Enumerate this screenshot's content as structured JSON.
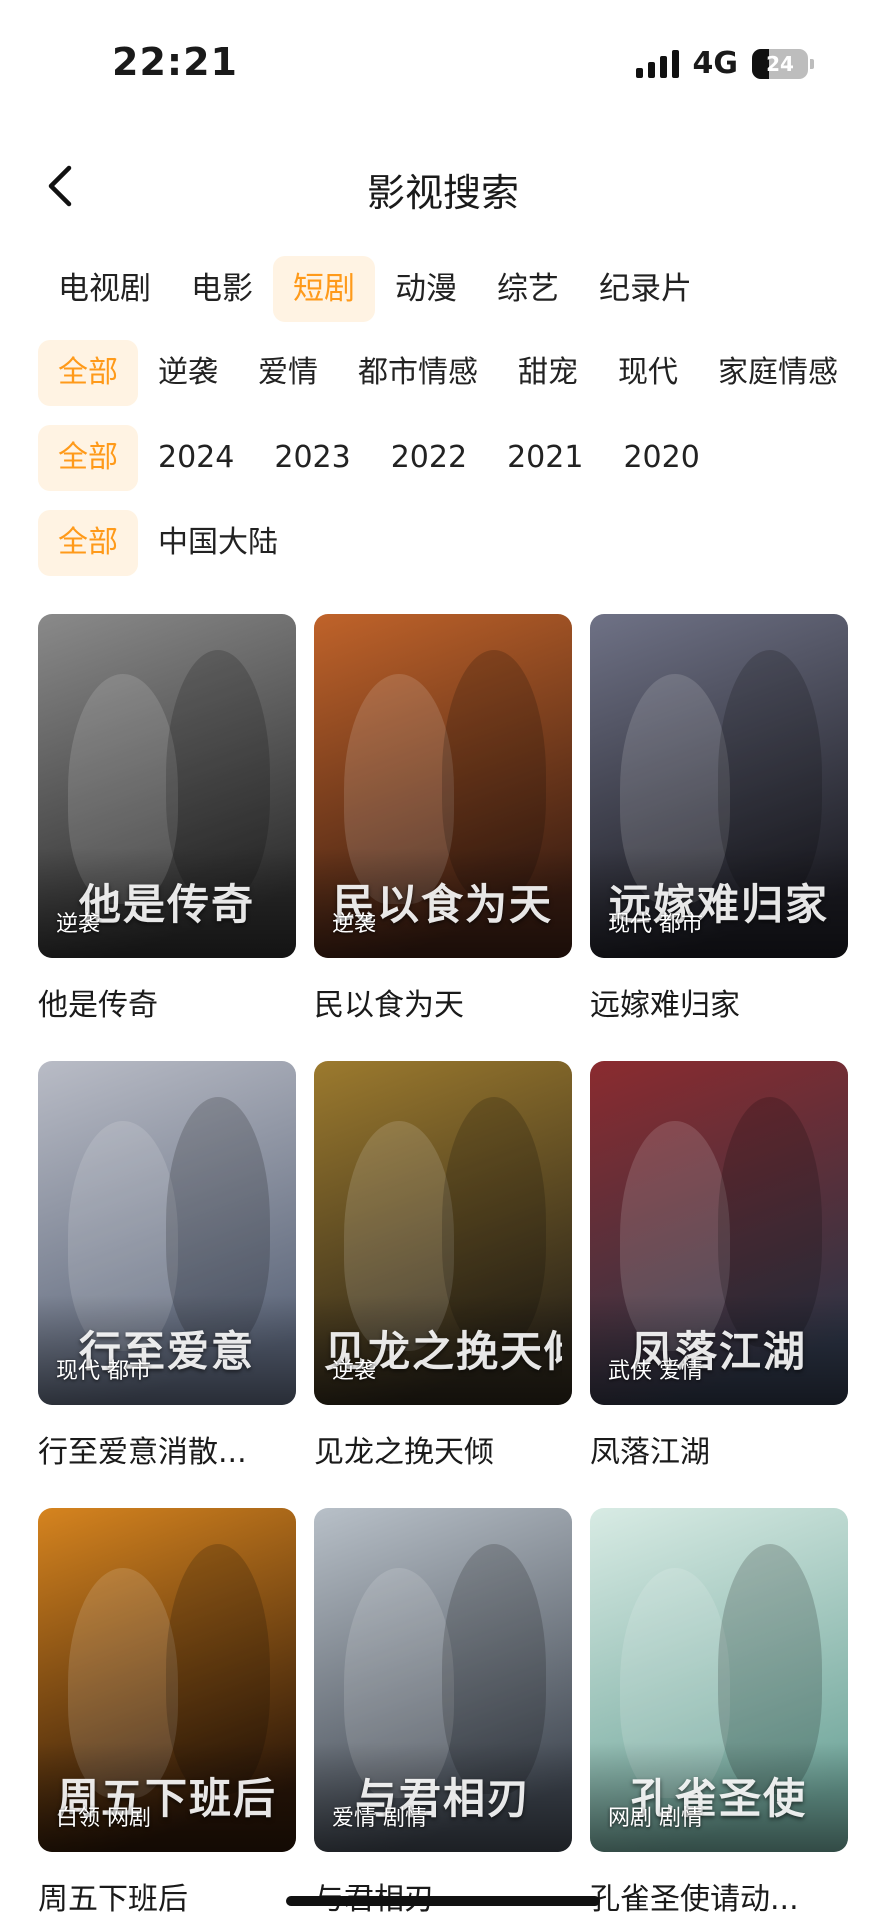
{
  "status": {
    "time": "22:21",
    "network": "4G",
    "battery": "24"
  },
  "nav": {
    "title": "影视搜索"
  },
  "type_tabs": [
    {
      "label": "电视剧",
      "active": false
    },
    {
      "label": "电影",
      "active": false
    },
    {
      "label": "短剧",
      "active": true
    },
    {
      "label": "动漫",
      "active": false
    },
    {
      "label": "综艺",
      "active": false
    },
    {
      "label": "纪录片",
      "active": false
    }
  ],
  "genre_filters": [
    {
      "label": "全部",
      "active": true
    },
    {
      "label": "逆袭",
      "active": false
    },
    {
      "label": "爱情",
      "active": false
    },
    {
      "label": "都市情感",
      "active": false
    },
    {
      "label": "甜宠",
      "active": false
    },
    {
      "label": "现代",
      "active": false
    },
    {
      "label": "家庭情感",
      "active": false
    }
  ],
  "year_filters": [
    {
      "label": "全部",
      "active": true
    },
    {
      "label": "2024",
      "active": false
    },
    {
      "label": "2023",
      "active": false
    },
    {
      "label": "2022",
      "active": false
    },
    {
      "label": "2021",
      "active": false
    },
    {
      "label": "2020",
      "active": false
    }
  ],
  "region_filters": [
    {
      "label": "全部",
      "active": true
    },
    {
      "label": "中国大陆",
      "active": false
    }
  ],
  "shows": [
    {
      "title": "他是传奇",
      "tags": "逆袭",
      "art_title": "他是传奇",
      "colors": [
        "#2b2b2b",
        "#8a8a8a"
      ]
    },
    {
      "title": "民以食为天",
      "tags": "逆袭",
      "art_title": "民以食为天",
      "colors": [
        "#3a1d12",
        "#c0632a"
      ]
    },
    {
      "title": "远嫁难归家",
      "tags": "现代 都市",
      "art_title": "远嫁难归家",
      "colors": [
        "#1b1b22",
        "#6f7286"
      ]
    },
    {
      "title": "行至爱意消散...",
      "tags": "现代 都市",
      "art_title": "行至爱意",
      "colors": [
        "#5a6478",
        "#b9bcc6"
      ]
    },
    {
      "title": "见龙之挽天倾",
      "tags": "逆袭",
      "art_title": "见龙之挽天倾",
      "colors": [
        "#2a2419",
        "#9c7a2e"
      ]
    },
    {
      "title": "凤落江湖",
      "tags": "武侠 爱情",
      "art_title": "凤落江湖",
      "colors": [
        "#2c3445",
        "#8b2b2f"
      ]
    },
    {
      "title": "周五下班后",
      "tags": "白领 网剧",
      "art_title": "周五下班后",
      "colors": [
        "#2a1608",
        "#d6841f"
      ]
    },
    {
      "title": "与君相刃",
      "tags": "爱情 剧情",
      "art_title": "与君相刃",
      "colors": [
        "#3f4650",
        "#b8c0c8"
      ]
    },
    {
      "title": "孔雀圣使请动...",
      "tags": "网剧 剧情",
      "art_title": "孔雀圣使",
      "colors": [
        "#6fa59a",
        "#d8ebe4"
      ]
    }
  ]
}
